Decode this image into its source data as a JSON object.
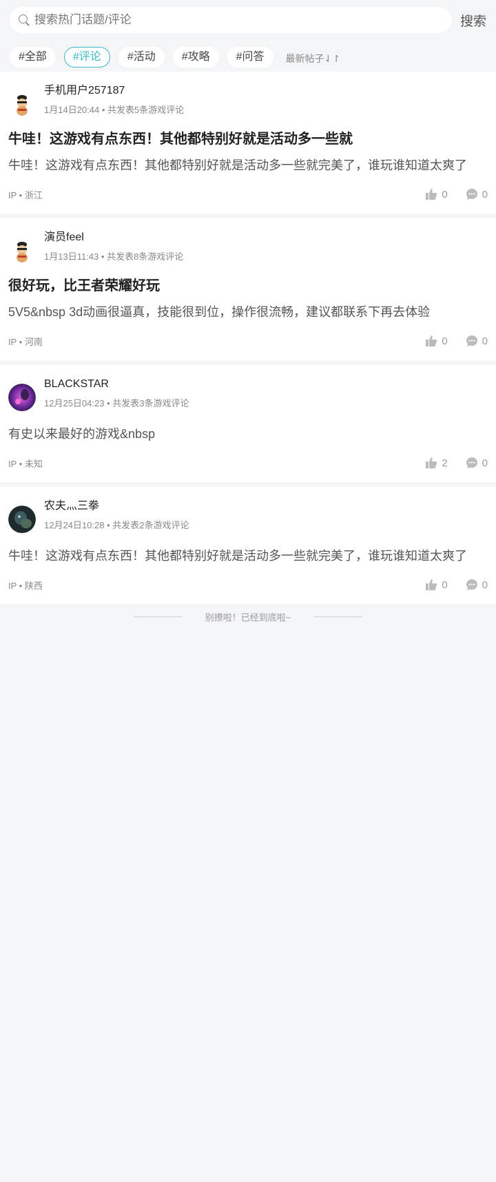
{
  "search": {
    "placeholder": "搜索热门话题/评论",
    "button_label": "搜索"
  },
  "tabs": [
    {
      "label": "#全部",
      "active": false
    },
    {
      "label": "#评论",
      "active": true
    },
    {
      "label": "#活动",
      "active": false
    },
    {
      "label": "#攻略",
      "active": false
    },
    {
      "label": "#问答",
      "active": false
    }
  ],
  "sort_label": "最新帖子⇃↾",
  "posts": [
    {
      "user": "手机用户257187",
      "date": "1月14日20:44",
      "count_text": "共发表5条游戏评论",
      "title": "牛哇！这游戏有点东西！其他都特别好就是活动多一些就",
      "body": "牛哇！这游戏有点东西！其他都特别好就是活动多一些就完美了，谁玩谁知道太爽了",
      "ip": "IP • 浙江",
      "likes": "0",
      "comments": "0"
    },
    {
      "user": "演员feel",
      "date": "1月13日11:43",
      "count_text": "共发表8条游戏评论",
      "title": "很好玩，比王者荣耀好玩",
      "body": "5V5&nbsp 3d动画很逼真，技能很到位，操作很流畅，建议都联系下再去体验",
      "ip": "IP • 河南",
      "likes": "0",
      "comments": "0"
    },
    {
      "user": "BLACKSTAR",
      "date": "12月25日04:23",
      "count_text": "共发表3条游戏评论",
      "title": "",
      "body": "有史以来最好的游戏&nbsp",
      "ip": "IP • 未知",
      "likes": "2",
      "comments": "0"
    },
    {
      "user": "农夫灬三拳",
      "date": "12月24日10:28",
      "count_text": "共发表2条游戏评论",
      "title": "",
      "body": "牛哇！这游戏有点东西！其他都特别好就是活动多一些就完美了，谁玩谁知道太爽了",
      "ip": "IP • 陕西",
      "likes": "0",
      "comments": "0"
    }
  ],
  "end_text": "别撩啦！已经到底啦~",
  "colors": {
    "accent": "#3bb8c8",
    "background": "#f4f5f7"
  }
}
